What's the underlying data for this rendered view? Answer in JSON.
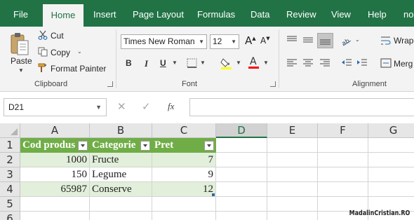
{
  "tabs": [
    "File",
    "Home",
    "Insert",
    "Page Layout",
    "Formulas",
    "Data",
    "Review",
    "View",
    "Help",
    "no"
  ],
  "active_tab": "Home",
  "clipboard": {
    "paste": "Paste",
    "cut": "Cut",
    "copy": "Copy",
    "format_painter": "Format Painter",
    "group_label": "Clipboard"
  },
  "font": {
    "family": "Times New Roman",
    "size": "12",
    "bold": "B",
    "italic": "I",
    "underline": "U",
    "font_color_letter": "A",
    "group_label": "Font",
    "highlight_color": "#ffff00",
    "font_color": "#ff0000"
  },
  "alignment": {
    "wrap_text": "Wrap",
    "merge": "Merg",
    "group_label": "Alignment"
  },
  "formula_bar": {
    "name_box": "D21",
    "fx": "fx",
    "formula": ""
  },
  "columns": [
    "A",
    "B",
    "C",
    "D",
    "E",
    "F",
    "G"
  ],
  "selected_column": "D",
  "rows": [
    "1",
    "2",
    "3",
    "4",
    "5",
    "6"
  ],
  "table": {
    "headers": [
      "Cod produs",
      "Categorie",
      "Pret"
    ],
    "rows": [
      [
        "1000",
        "Fructe",
        "7"
      ],
      [
        "150",
        "Legume",
        "9"
      ],
      [
        "65987",
        "Conserve",
        "12"
      ]
    ],
    "header_color": "#70ad47",
    "band_color": "#e2efda"
  },
  "watermark": "MadalinCristian.RO",
  "colors": {
    "accent": "#217346"
  }
}
